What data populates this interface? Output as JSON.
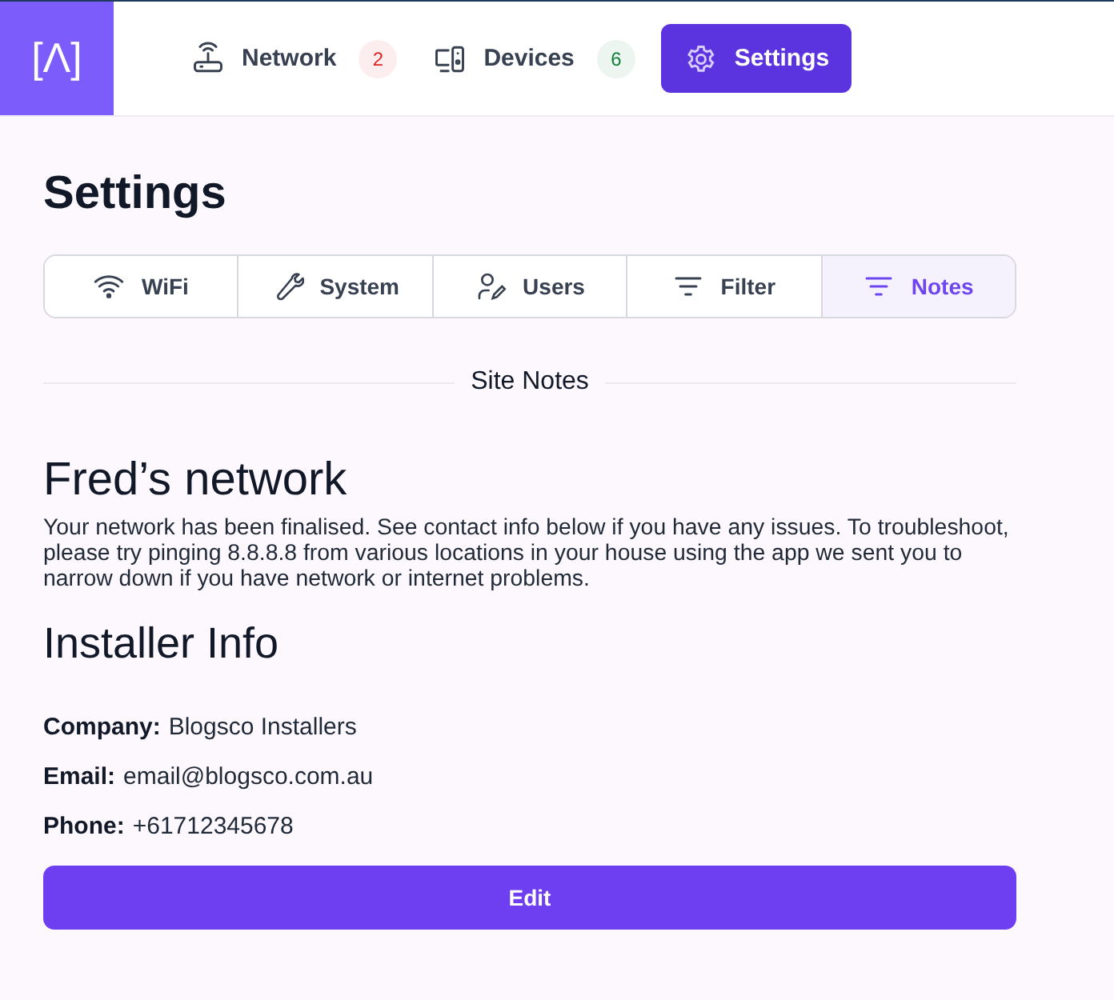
{
  "logo": {
    "text": "[Λ]"
  },
  "nav": [
    {
      "label": "Network",
      "kind": "router",
      "badge": "2",
      "color": "#dc2626",
      "selected": false
    },
    {
      "label": "Devices",
      "kind": "devices",
      "badge": "6",
      "color": "#15803d",
      "selected": false
    },
    {
      "label": "Settings",
      "kind": "gear",
      "selected": true
    }
  ],
  "page_title": "Settings",
  "tabs": [
    {
      "label": "WiFi",
      "kind": "wifi",
      "selected": false
    },
    {
      "label": "System",
      "kind": "wrench",
      "selected": false
    },
    {
      "label": "Users",
      "kind": "users",
      "selected": false
    },
    {
      "label": "Filter",
      "kind": "filter",
      "selected": false
    },
    {
      "label": "Notes",
      "kind": "filter",
      "selected": true
    }
  ],
  "section_title": "Site Notes",
  "network_title": "Fred’s network",
  "note": "Your network has been finalised. See contact info below if you have any issues. To troubleshoot, please try pinging 8.8.8.8 from various locations in your house using the app we sent you to narrow down if you have network or internet problems.",
  "installer_title": "Installer Info",
  "installer": [
    {
      "label": "Company:",
      "value": "Blogsco Installers"
    },
    {
      "label": "Email:",
      "value": "email@blogsco.com.au"
    },
    {
      "label": "Phone:",
      "value": "+61712345678"
    }
  ],
  "edit_button": "Edit"
}
